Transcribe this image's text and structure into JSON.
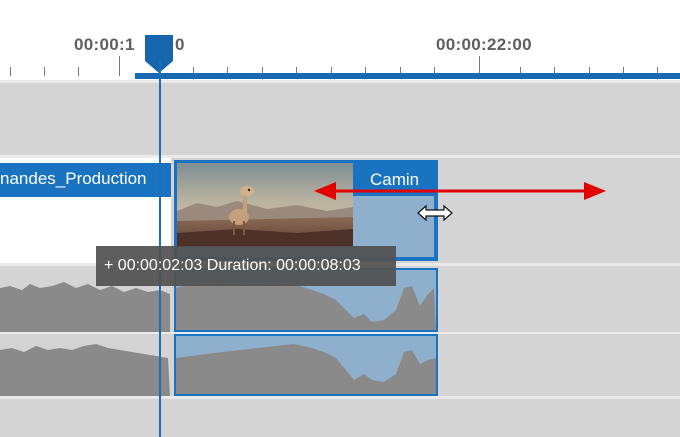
{
  "ruler": {
    "label_left": "00:00:1",
    "label_left_tail": "0",
    "label_right": "00:00:22:00"
  },
  "tracks": {
    "video": {
      "clip_left_title": "nandes_Production",
      "clip_right_title": "Camin"
    }
  },
  "tooltip": {
    "text": "+ 00:00:02:03 Duration: 00:00:08:03"
  },
  "icons": {
    "resize_cursor": "horizontal-resize-cursor-icon",
    "drag_arrow": "double-headed-arrow-icon"
  },
  "colors": {
    "accent": "#1a73c0",
    "track_bg": "#d4d4d4",
    "audio_wave": "#8a8a8a",
    "selected_clip": "#8fb0cc",
    "annotation_arrow": "#e00000"
  }
}
